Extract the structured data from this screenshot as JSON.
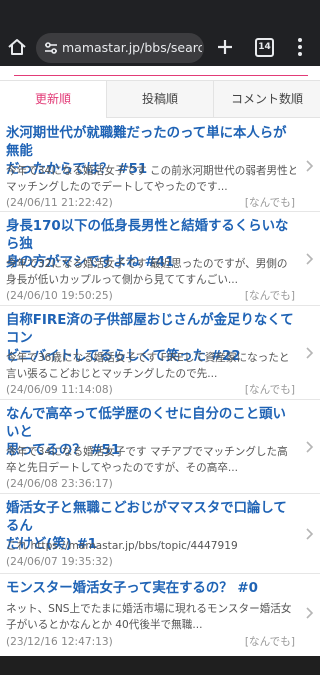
{
  "browser": {
    "url": "mamastar.jp/bbs/search",
    "tab_count": "14"
  },
  "sort_tabs": [
    {
      "label": "更新順",
      "active": true
    },
    {
      "label": "投稿順",
      "active": false
    },
    {
      "label": "コメント数順",
      "active": false
    }
  ],
  "topics": [
    {
      "title_line1": "氷河期世代が就職難だったのって単に本人らが無能",
      "title_line2": "だったからでは？ #51",
      "excerpt_line1": "今年で34になる婚活女子です この前氷河期世代の弱者男性と",
      "excerpt_line2": "マッチングしたのでデートしてやったのです...",
      "date": "(24/06/11 21:22:42)",
      "category": "[なんでも]"
    },
    {
      "title_line1": "身長170以下の低身長男性と結婚するくらいなら独",
      "title_line2": "身の方がマシですよね #41",
      "excerpt_line1": "今年で32になる婚活女子です 最近思ったのですが、男側の",
      "excerpt_line2": "身長が低いカップルって側から見ててすんごい...",
      "date": "(24/06/10 19:50:25)",
      "category": "[なんでも]"
    },
    {
      "title_line1": "自称FIRE済の子供部屋おじさんが金足りなくてコン",
      "title_line2": "ビニバイトしてるらしくて笑った #22",
      "excerpt_line1": "今年で36歳になる婚活女子です FIREして資産家になったと",
      "excerpt_line2": "言い張るこどおじとマッチングしたので先...",
      "date": "(24/06/09 11:14:08)",
      "category": "[なんでも]"
    },
    {
      "title_line1": "なんで高卒って低学歴のくせに自分のこと頭いいと",
      "title_line2": "思ってるの？ #51",
      "excerpt_line1": "今年で34になる婚活女子です マチアプでマッチングした高",
      "excerpt_line2": "卒と先日デートしてやったのですが、その高卒...",
      "date": "(24/06/08 23:36:17)",
      "category": "[なんでも]"
    },
    {
      "title_line1": "婚活女子と無職こどおじがママスタで口論してるん",
      "title_line2": "だけど(笑) #1",
      "excerpt_line1": "これ https://mamastar.jp/bbs/topic/4447919",
      "excerpt_line2": "",
      "date": "(24/06/07 19:35:32)",
      "category": "[なんでも]"
    },
    {
      "title_line1": "モンスター婚活女子って実在するの？ #0",
      "title_line2": "",
      "excerpt_line1": "ネット、SNS上でたまに婚活市場に現れるモンスター婚活女",
      "excerpt_line2": "子がいるとかなんとか 40代後半で無職...",
      "date": "(23/12/16 12:47:13)",
      "category": "[なんでも]"
    }
  ]
}
